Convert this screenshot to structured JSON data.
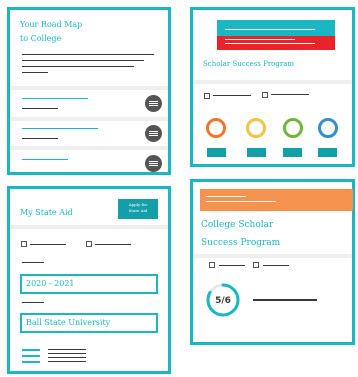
{
  "roadmap": {
    "title_line1": "Your Road Map",
    "title_line2": "to College"
  },
  "scholar_success": {
    "title": "Scholar Success Program",
    "ring_colors": [
      "#f0762e",
      "#f5c243",
      "#72b43b",
      "#2f8fcf"
    ]
  },
  "state_aid": {
    "title": "My State Aid",
    "apply_line1": "Apply for",
    "apply_line2": "State Aid",
    "year": "2020 - 2021",
    "school": "Ball State University"
  },
  "college_scholar": {
    "title_line1": "College Scholar",
    "title_line2": "Success Program",
    "progress_text": "5/6",
    "progress_fraction": 0.8333
  },
  "colors": {
    "accent": "#1bb6c4",
    "button": "#139fa8",
    "red": "#e8232a",
    "orange": "#f5924d"
  }
}
